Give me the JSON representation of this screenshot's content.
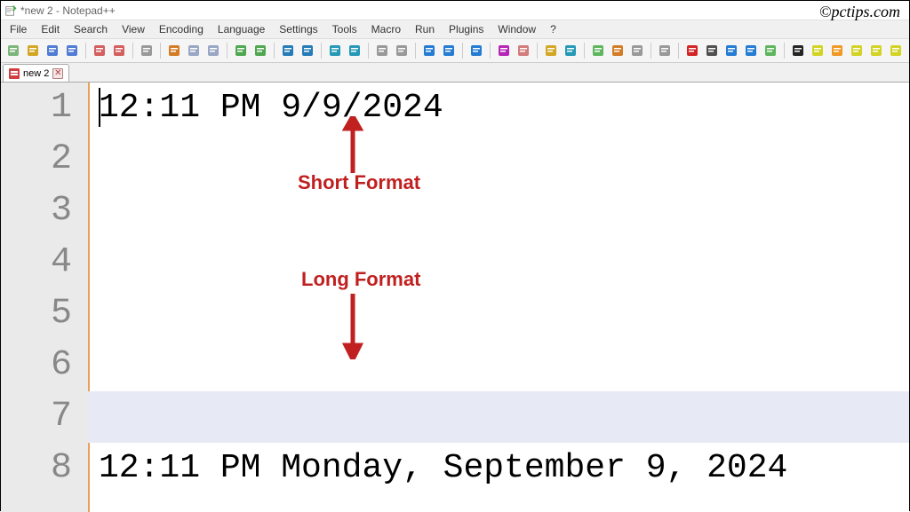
{
  "title": "*new 2 - Notepad++",
  "watermark": "©pctips.com",
  "menu": [
    "File",
    "Edit",
    "Search",
    "View",
    "Encoding",
    "Language",
    "Settings",
    "Tools",
    "Macro",
    "Run",
    "Plugins",
    "Window",
    "?"
  ],
  "tab": {
    "label": "new 2",
    "close": "✕"
  },
  "gutter": [
    "1",
    "2",
    "3",
    "4",
    "5",
    "6",
    "7",
    "8"
  ],
  "lines": {
    "l1": "12:11 PM 9/9/2024",
    "l2": "",
    "l3": "",
    "l4": "",
    "l5": "",
    "l6": "",
    "l7": "",
    "l8": "12:11 PM Monday, September 9, 2024"
  },
  "annotations": {
    "short": "Short Format",
    "long": "Long Format"
  },
  "toolbar_icons": [
    "new-file",
    "open-file",
    "save",
    "save-all",
    "sep",
    "close",
    "close-all",
    "sep",
    "print",
    "sep",
    "cut",
    "copy",
    "paste",
    "sep",
    "undo",
    "redo",
    "sep",
    "find",
    "replace",
    "sep",
    "zoom-in",
    "zoom-out",
    "sep",
    "sync-v",
    "sync-h",
    "sep",
    "word-wrap",
    "show-all",
    "sep",
    "indent-guide",
    "sep",
    "lang",
    "user-lang",
    "sep",
    "folder",
    "monitor",
    "sep",
    "doc-map",
    "doc-list",
    "func-list",
    "sep",
    "spell",
    "sep",
    "record",
    "stop",
    "play",
    "play-multi",
    "save-macro",
    "sep",
    "hex",
    "smiley",
    "n-badge",
    "s-badge",
    "o-badge",
    "l-badge"
  ],
  "icon_colors": {
    "new-file": "#6a6",
    "open-file": "#c90",
    "save": "#36c",
    "save-all": "#36c",
    "close": "#c44",
    "close-all": "#c44",
    "print": "#888",
    "cut": "#c60",
    "copy": "#89b",
    "paste": "#89b",
    "undo": "#393",
    "redo": "#393",
    "find": "#06a",
    "replace": "#06a",
    "zoom-in": "#08a",
    "zoom-out": "#08a",
    "sync-v": "#888",
    "sync-h": "#888",
    "word-wrap": "#06c",
    "show-all": "#06c",
    "indent-guide": "#06c",
    "lang": "#a0a",
    "user-lang": "#c66",
    "folder": "#c90",
    "monitor": "#08a",
    "doc-map": "#4a4",
    "doc-list": "#c60",
    "func-list": "#888",
    "spell": "#888",
    "record": "#c00",
    "stop": "#333",
    "play": "#06c",
    "play-multi": "#06c",
    "save-macro": "#4a4",
    "hex": "#000",
    "smiley": "#cc0",
    "n-badge": "#e80",
    "s-badge": "#cc0",
    "o-badge": "#cc0",
    "l-badge": "#cc0"
  }
}
